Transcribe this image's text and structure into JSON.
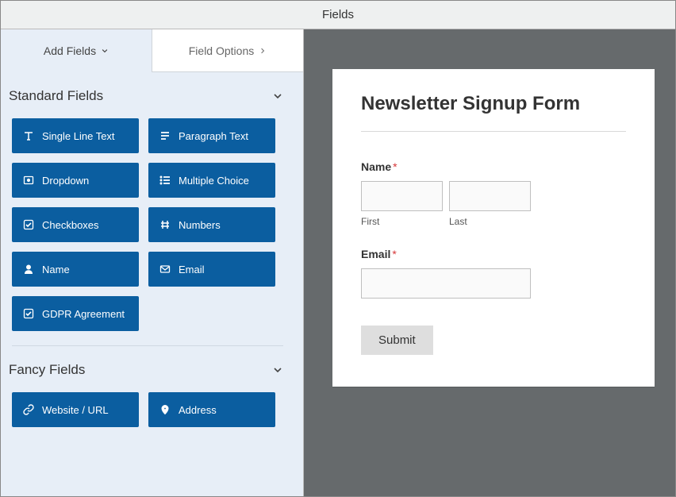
{
  "window": {
    "title": "Fields"
  },
  "tabs": {
    "add": "Add Fields",
    "options": "Field Options"
  },
  "sections": {
    "standard": {
      "title": "Standard Fields",
      "items": [
        {
          "label": "Single Line Text",
          "icon": "text-icon"
        },
        {
          "label": "Paragraph Text",
          "icon": "paragraph-icon"
        },
        {
          "label": "Dropdown",
          "icon": "dropdown-icon"
        },
        {
          "label": "Multiple Choice",
          "icon": "list-icon"
        },
        {
          "label": "Checkboxes",
          "icon": "check-icon"
        },
        {
          "label": "Numbers",
          "icon": "hash-icon"
        },
        {
          "label": "Name",
          "icon": "user-icon"
        },
        {
          "label": "Email",
          "icon": "envelope-icon"
        },
        {
          "label": "GDPR Agreement",
          "icon": "check-icon"
        }
      ]
    },
    "fancy": {
      "title": "Fancy Fields",
      "items": [
        {
          "label": "Website / URL",
          "icon": "link-icon"
        },
        {
          "label": "Address",
          "icon": "pin-icon"
        }
      ]
    }
  },
  "form": {
    "title": "Newsletter Signup Form",
    "name_label": "Name",
    "first_sub": "First",
    "last_sub": "Last",
    "email_label": "Email",
    "submit": "Submit"
  }
}
